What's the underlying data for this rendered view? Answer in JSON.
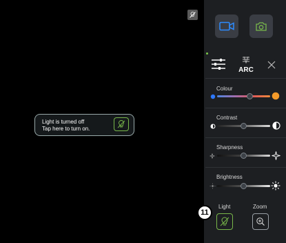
{
  "toast": {
    "line1": "Light is turned off",
    "line2": "Tap here to turn on."
  },
  "sliders": [
    {
      "label": "Colour",
      "value": 0.62
    },
    {
      "label": "Contrast",
      "value": 0.5
    },
    {
      "label": "Sharpness",
      "value": 0.5
    },
    {
      "label": "Brightness",
      "value": 0.5
    }
  ],
  "tabs": {
    "arc_label": "ARC"
  },
  "bottom": {
    "light_label": "Light",
    "zoom_label": "Zoom"
  },
  "badge": {
    "number": "11"
  },
  "colors": {
    "accent_green": "#79b84a",
    "video_blue": "#2d8cff"
  }
}
